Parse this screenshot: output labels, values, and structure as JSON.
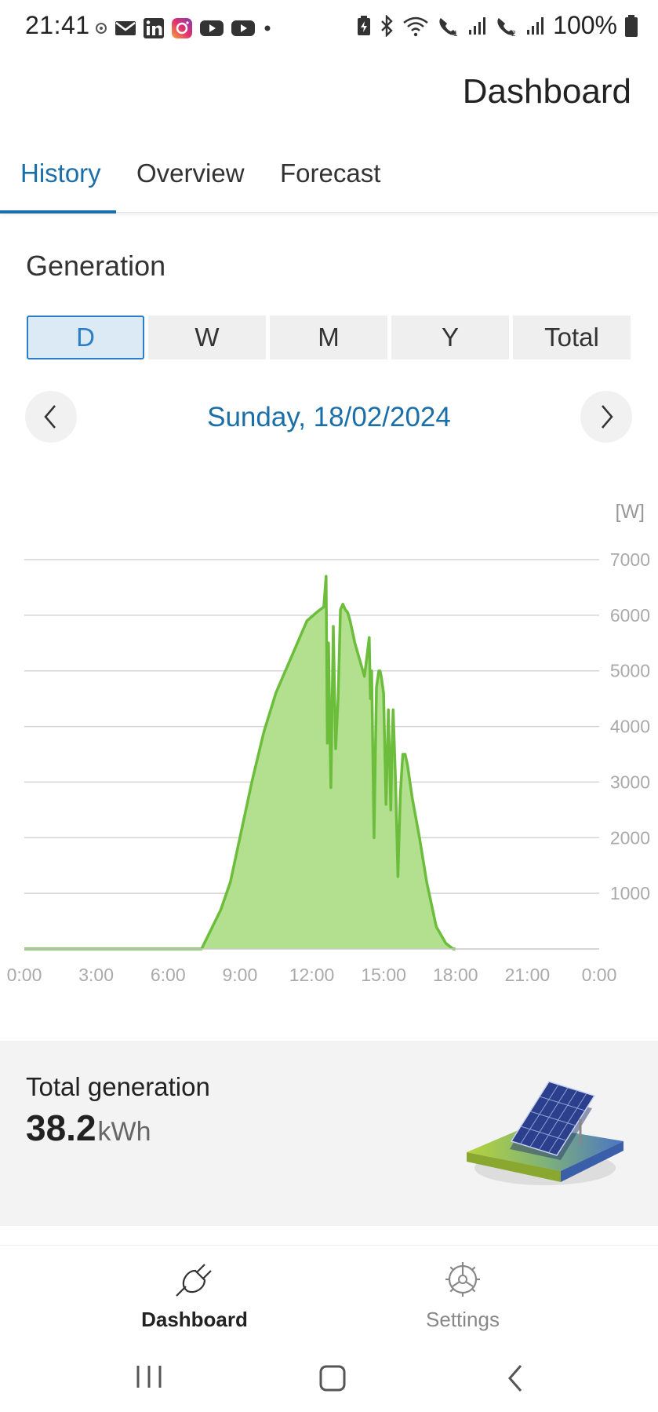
{
  "status_bar": {
    "time": "21:41",
    "left_icons": [
      "notification-icon",
      "mail-icon",
      "linkedin-icon",
      "instagram-icon",
      "youtube-icon",
      "youtube-icon",
      "dot-icon"
    ],
    "right_icons": [
      "battery-saver-icon",
      "bluetooth-icon",
      "wifi-icon",
      "wifi-call-sim1-icon",
      "signal-sim1-icon",
      "wifi-call-sim2-icon",
      "signal-sim2-icon"
    ],
    "battery": "100%"
  },
  "header": {
    "title": "Dashboard"
  },
  "tabs": [
    {
      "label": "History",
      "active": true
    },
    {
      "label": "Overview",
      "active": false
    },
    {
      "label": "Forecast",
      "active": false
    }
  ],
  "generation": {
    "title": "Generation",
    "periods": [
      {
        "label": "D",
        "active": true
      },
      {
        "label": "W",
        "active": false
      },
      {
        "label": "M",
        "active": false
      },
      {
        "label": "Y",
        "active": false
      },
      {
        "label": "Total",
        "active": false
      }
    ],
    "date": "Sunday, 18/02/2024"
  },
  "chart_data": {
    "type": "area",
    "unit_label": "[W]",
    "xlabel": "",
    "ylabel": "",
    "x_ticks": [
      "0:00",
      "3:00",
      "6:00",
      "9:00",
      "12:00",
      "15:00",
      "18:00",
      "21:00",
      "0:00"
    ],
    "y_ticks": [
      1000,
      2000,
      3000,
      4000,
      5000,
      6000,
      7000
    ],
    "xlim": [
      0,
      24
    ],
    "ylim": [
      0,
      7000
    ],
    "grid": true,
    "color": "#6cbd3c",
    "fill_color": "#b2e08e",
    "series": [
      {
        "x": [
          0,
          7.4,
          8.2,
          8.6,
          9.0,
          9.5,
          10.0,
          10.5,
          11.0,
          11.5,
          11.8,
          12.2,
          12.5,
          12.6,
          12.65,
          12.7,
          12.8,
          12.9,
          13.0,
          13.1,
          13.2,
          13.3,
          13.35,
          13.4,
          13.5,
          13.6,
          13.8,
          14.0,
          14.2,
          14.4,
          14.45,
          14.5,
          14.6,
          14.7,
          14.8,
          14.85,
          14.9,
          15.0,
          15.1,
          15.2,
          15.3,
          15.35,
          15.4,
          15.5,
          15.6,
          15.7,
          15.8,
          15.9,
          16.0,
          16.1,
          16.2,
          16.5,
          16.8,
          17.2,
          17.6,
          17.9,
          18.0
        ],
        "y": [
          0,
          0,
          700,
          1200,
          2000,
          3000,
          3900,
          4600,
          5100,
          5600,
          5900,
          6050,
          6150,
          6700,
          3700,
          5500,
          2900,
          5800,
          3600,
          4500,
          6100,
          6200,
          6150,
          6100,
          6050,
          5900,
          5500,
          5200,
          4900,
          5600,
          4500,
          5000,
          2000,
          4700,
          5000,
          5000,
          4900,
          4600,
          2600,
          4300,
          2500,
          3600,
          4300,
          3000,
          1300,
          2800,
          3500,
          3500,
          3300,
          3000,
          2700,
          2000,
          1200,
          400,
          100,
          0,
          0
        ]
      }
    ]
  },
  "total_generation": {
    "label": "Total generation",
    "value": "38.2",
    "unit": "kWh"
  },
  "bottom_nav": [
    {
      "label": "Dashboard",
      "icon": "plug-icon",
      "active": true
    },
    {
      "label": "Settings",
      "icon": "gear-icon",
      "active": false
    }
  ],
  "system_nav": [
    "recent-apps-icon",
    "home-icon",
    "back-icon"
  ]
}
